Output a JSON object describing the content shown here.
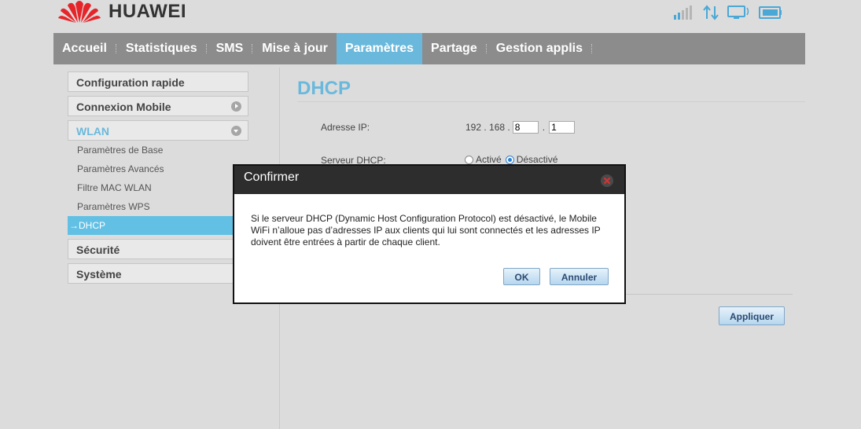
{
  "brand": {
    "name": "HUAWEI",
    "color": "#e6252a"
  },
  "status_icons": [
    "signal-icon",
    "data-transfer-icon",
    "computer-connected-icon",
    "battery-icon"
  ],
  "nav": {
    "items": [
      "Accueil",
      "Statistiques",
      "SMS",
      "Mise à jour",
      "Paramètres",
      "Partage",
      "Gestion applis"
    ],
    "active": "Paramètres"
  },
  "sidebar": {
    "quick": "Configuration rapide",
    "mobile": "Connexion Mobile",
    "wlan": "WLAN",
    "wlan_items": [
      "Paramètres de Base",
      "Paramètres Avancés",
      "Filtre MAC WLAN",
      "Paramètres WPS",
      "DHCP"
    ],
    "security": "Sécurité",
    "system": "Système"
  },
  "content": {
    "title": "DHCP",
    "ip_label": "Adresse IP:",
    "ip_fixed": "192 . 168 .",
    "ip_octet3": "8",
    "ip_dot": ".",
    "ip_octet4": "1",
    "dhcp_label": "Serveur DHCP:",
    "dhcp_on": "Activé",
    "dhcp_off": "Désactivé",
    "dhcp_state": "Désactivé",
    "apply": "Appliquer"
  },
  "dialog": {
    "title": "Confirmer",
    "message": "Si le serveur DHCP (Dynamic Host Configuration Protocol) est désactivé, le Mobile WiFi n’alloue pas d’adresses IP aux clients qui lui sont connectés et les adresses IP doivent être entrées à partir de chaque client.",
    "ok": "OK",
    "cancel": "Annuler"
  },
  "colors": {
    "accent": "#6ab9dc",
    "nav_bg": "#8c8c8c",
    "active_item": "#62c0e4"
  }
}
